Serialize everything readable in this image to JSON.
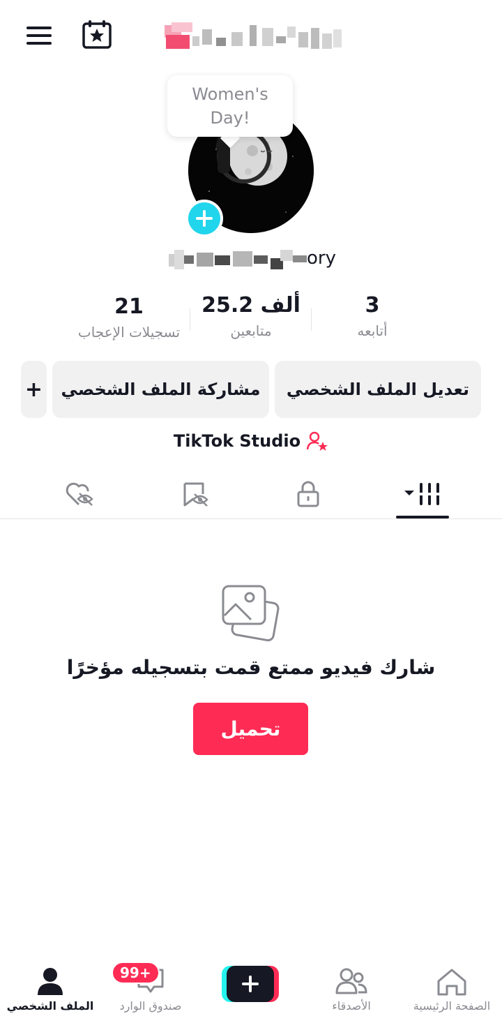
{
  "header": {
    "menu_icon": "hamburger-menu-icon",
    "calendar_icon": "calendar-star-icon"
  },
  "tooltip": {
    "text": "Women's Day!"
  },
  "profile": {
    "username_visible": "ory",
    "add_icon": "plus-icon"
  },
  "stats": [
    {
      "value": "21",
      "label": "تسجيلات الإعجاب"
    },
    {
      "value": "25.2 ألف",
      "label": "متابعين"
    },
    {
      "value": "3",
      "label": "أتابعه"
    }
  ],
  "buttons": {
    "edit_profile": "تعديل الملف الشخصي",
    "share_profile": "مشاركة الملف الشخصي",
    "more": "+"
  },
  "studio": {
    "label": "TikTok Studio",
    "icon": "person-star-icon"
  },
  "tabs": [
    {
      "icon": "videos-grid-icon",
      "active": true
    },
    {
      "icon": "lock-icon",
      "active": false
    },
    {
      "icon": "bookmark-hidden-icon",
      "active": false
    },
    {
      "icon": "heart-hidden-icon",
      "active": false
    }
  ],
  "empty_state": {
    "icon": "photo-stack-icon",
    "message": "شارك فيديو ممتع قمت بتسجيله مؤخرًا",
    "upload_label": "تحميل"
  },
  "bottom_nav": {
    "profile": "الملف الشخصي",
    "inbox": "صندوق الوارد",
    "inbox_badge": "99+",
    "friends": "الأصدقاء",
    "home": "الصفحة الرئيسية"
  },
  "colors": {
    "accent": "#fe2c55",
    "cyan": "#25f4ee",
    "text": "#161823",
    "muted": "#8a8b91"
  }
}
